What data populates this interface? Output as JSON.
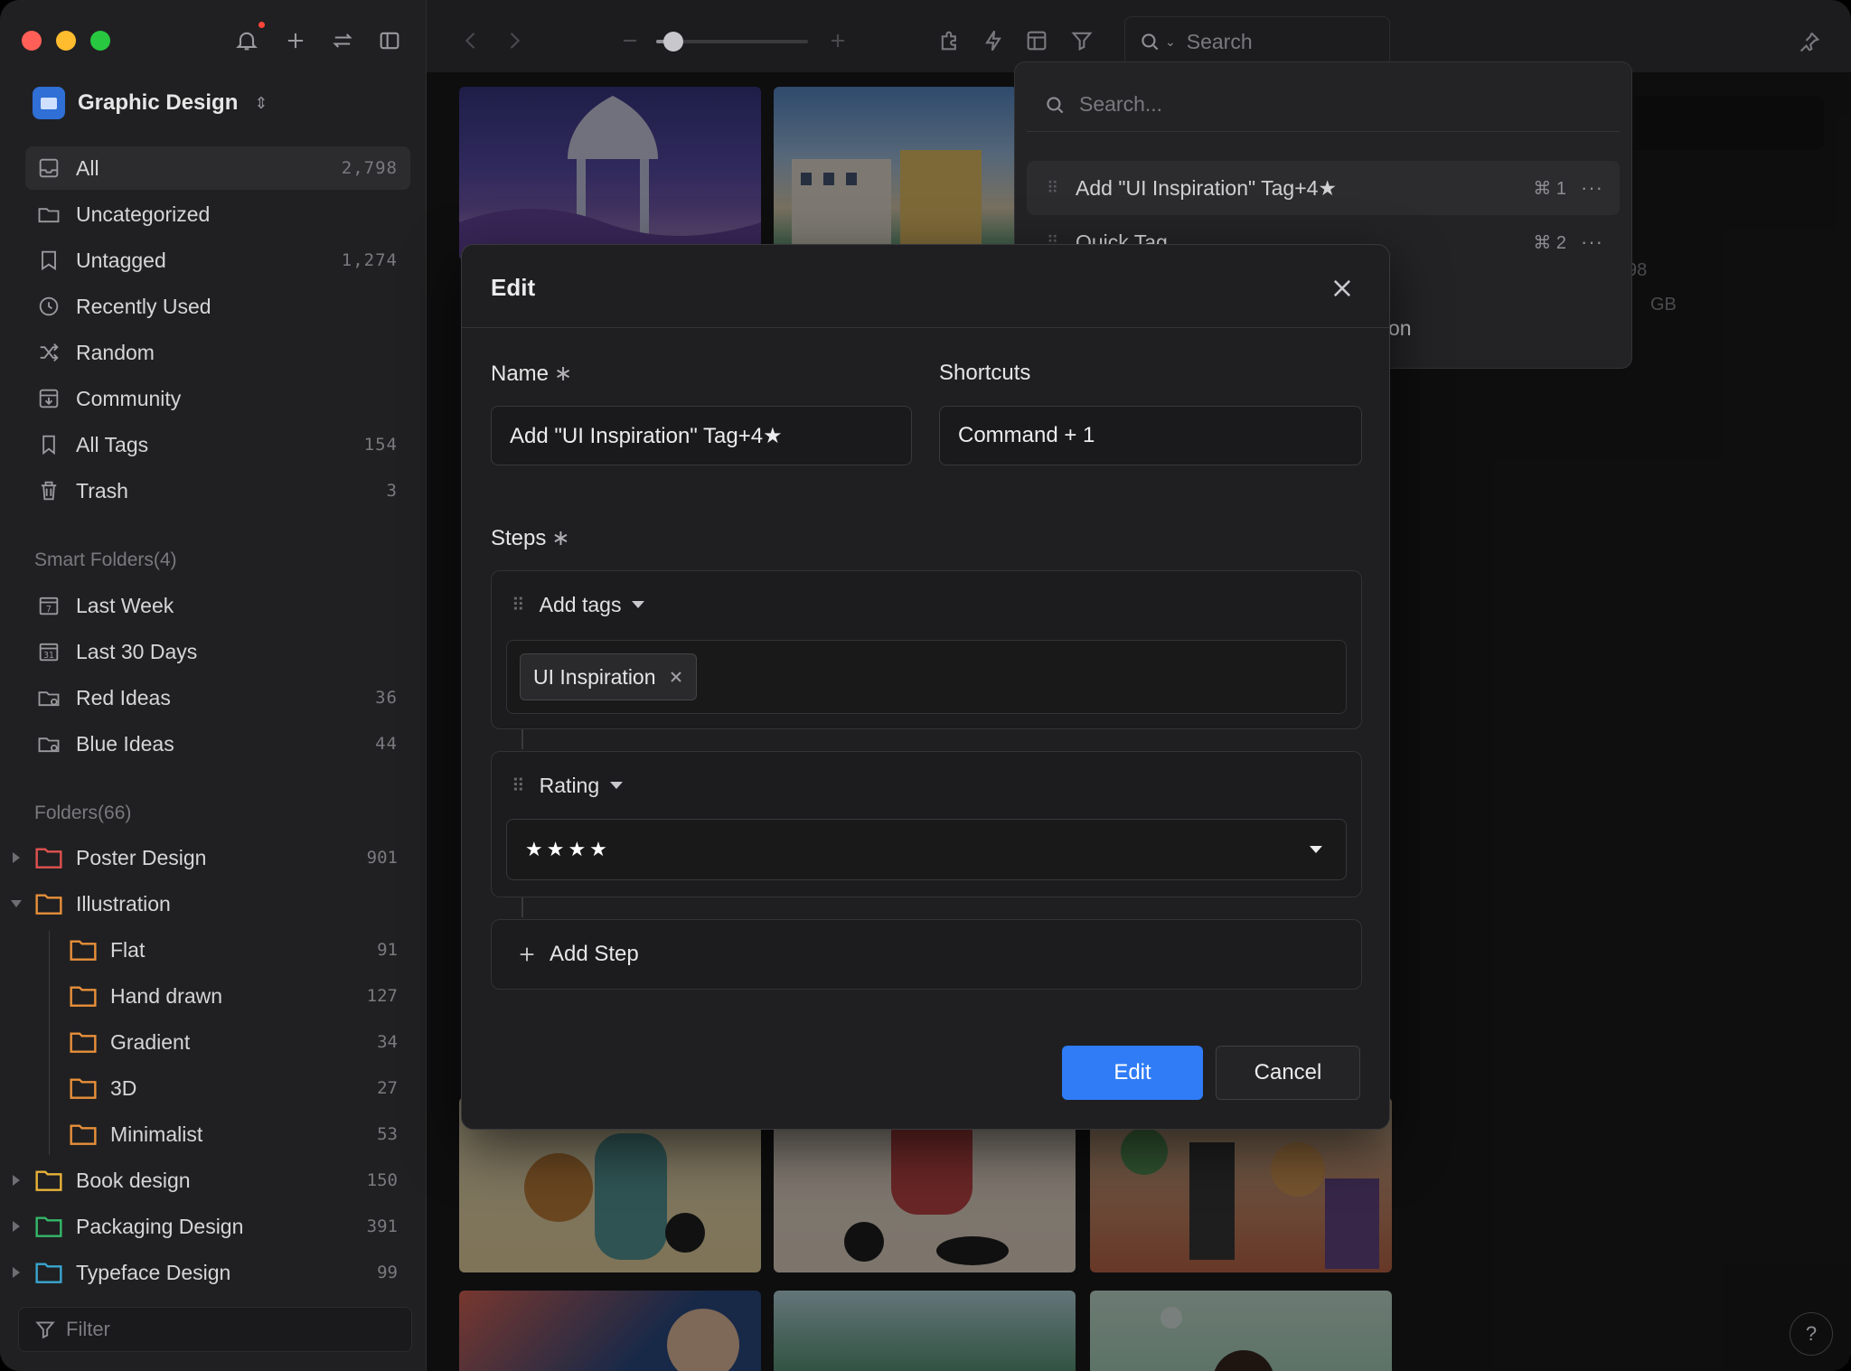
{
  "app": {
    "library_name": "Graphic Design",
    "accent": "#2f7cf6"
  },
  "sidebar": {
    "items": [
      {
        "label": "All",
        "count": "2,798",
        "icon": "inbox-icon"
      },
      {
        "label": "Uncategorized",
        "count": "",
        "icon": "folder-question-icon"
      },
      {
        "label": "Untagged",
        "count": "1,274",
        "icon": "tag-question-icon"
      },
      {
        "label": "Recently Used",
        "count": "",
        "icon": "clock-icon"
      },
      {
        "label": "Random",
        "count": "",
        "icon": "shuffle-icon"
      },
      {
        "label": "Community",
        "count": "",
        "icon": "download-box-icon"
      },
      {
        "label": "All Tags",
        "count": "154",
        "icon": "bookmark-icon"
      },
      {
        "label": "Trash",
        "count": "3",
        "icon": "trash-icon"
      }
    ],
    "smart_folders_title": "Smart Folders(4)",
    "smart_folders": [
      {
        "label": "Last Week",
        "count": "",
        "icon_text": "7"
      },
      {
        "label": "Last 30 Days",
        "count": "",
        "icon_text": "31"
      },
      {
        "label": "Red Ideas",
        "count": "36"
      },
      {
        "label": "Blue Ideas",
        "count": "44"
      }
    ],
    "folders_title": "Folders(66)",
    "folders": [
      {
        "label": "Poster Design",
        "count": "901",
        "color": "#e0524f"
      },
      {
        "label": "Illustration",
        "count": "",
        "color": "#e8903a"
      },
      {
        "label": "Flat",
        "count": "91",
        "color": "#e8903a"
      },
      {
        "label": "Hand drawn",
        "count": "127",
        "color": "#e8903a"
      },
      {
        "label": "Gradient",
        "count": "34",
        "color": "#e8903a"
      },
      {
        "label": "3D",
        "count": "27",
        "color": "#e8903a"
      },
      {
        "label": "Minimalist",
        "count": "53",
        "color": "#e8903a"
      },
      {
        "label": "Book design",
        "count": "150",
        "color": "#e8b33a"
      },
      {
        "label": "Packaging Design",
        "count": "391",
        "color": "#35b86a"
      },
      {
        "label": "Typeface Design",
        "count": "99",
        "color": "#3aa6d0"
      }
    ],
    "filter_placeholder": "Filter"
  },
  "toolbar": {
    "search_placeholder": "Search"
  },
  "quick_actions": {
    "search_placeholder": "Search...",
    "rows": [
      {
        "label": "Add \"UI Inspiration\" Tag+4★",
        "key": "⌘ 1",
        "more": "···"
      },
      {
        "label": "Quick Tag",
        "key": "⌘ 2",
        "more": "···"
      }
    ],
    "peek_a": "98",
    "peek_b": "GB",
    "peek_c": "on"
  },
  "modal": {
    "title": "Edit",
    "name_label": "Name",
    "required_mark": "∗",
    "name_value": "Add \"UI Inspiration\" Tag+4★",
    "shortcuts_label": "Shortcuts",
    "shortcut_value": "Command + 1",
    "steps_label": "Steps",
    "steps": [
      {
        "name": "Add tags",
        "tag": "UI Inspiration"
      },
      {
        "name": "Rating",
        "value": "★★★★"
      }
    ],
    "add_step_label": "Add Step",
    "primary_label": "Edit",
    "cancel_label": "Cancel"
  },
  "help_label": "?"
}
